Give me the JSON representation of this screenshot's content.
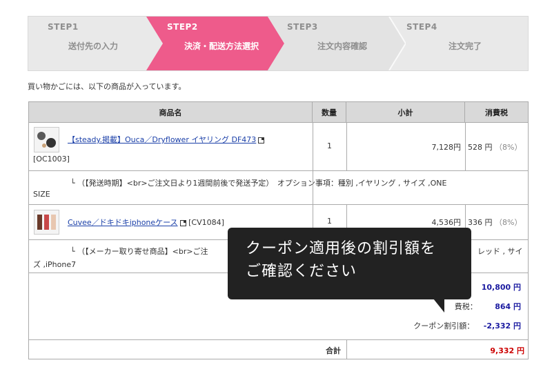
{
  "steps": [
    {
      "num": "STEP1",
      "label": "送付先の入力",
      "active": false
    },
    {
      "num": "STEP2",
      "label": "決済・配送方法選択",
      "active": true
    },
    {
      "num": "STEP3",
      "label": "注文内容確認",
      "active": false
    },
    {
      "num": "STEP4",
      "label": "注文完了",
      "active": false
    }
  ],
  "colors": {
    "active_step": "#ee5b8b",
    "inactive_step": "#e9e9e9",
    "header_bg": "#d9d9d9",
    "tooltip_bg": "#222222"
  },
  "intro_text": "買い物かごには、以下の商品が入っています。",
  "table": {
    "headers": {
      "name": "商品名",
      "qty": "数量",
      "subtotal": "小計",
      "tax": "消費税"
    },
    "items": [
      {
        "link": "【steady.掲載】Ouca／Dryflower イヤリング DF473",
        "code": "[OC1003]",
        "qty": "1",
        "subtotal": "7,128円",
        "tax": "528 円",
        "tax_rate": "（8%）",
        "note_line1": "└ （【発送時期】<br>ご注文日より1週間前後で発送予定）　オプション事項：種別 ,イヤリング , サイズ ,ONE",
        "note_line2": "SIZE"
      },
      {
        "link": "Cuvee／ドキドキiphoneケース",
        "code": "[CV1084]",
        "qty": "1",
        "subtotal": "4,536円",
        "tax": "336 円",
        "tax_rate": "（8%）",
        "note_line1": "└ （【メーカー取り寄せ商品】<br>ご注",
        "note_tail": "レッド , サイ",
        "note_line2": "ズ ,iPhone7"
      }
    ],
    "summary": {
      "subtotal_value": "10,800 円",
      "tax_label": "費税：",
      "tax_value": "864 円",
      "coupon_label": "クーポン割引額：",
      "coupon_value": "-2,332 円"
    },
    "total_label": "合計",
    "total_value": "9,332 円"
  },
  "tooltip": {
    "line1": "クーポン適用後の割引額を",
    "line2": "ご確認ください"
  }
}
